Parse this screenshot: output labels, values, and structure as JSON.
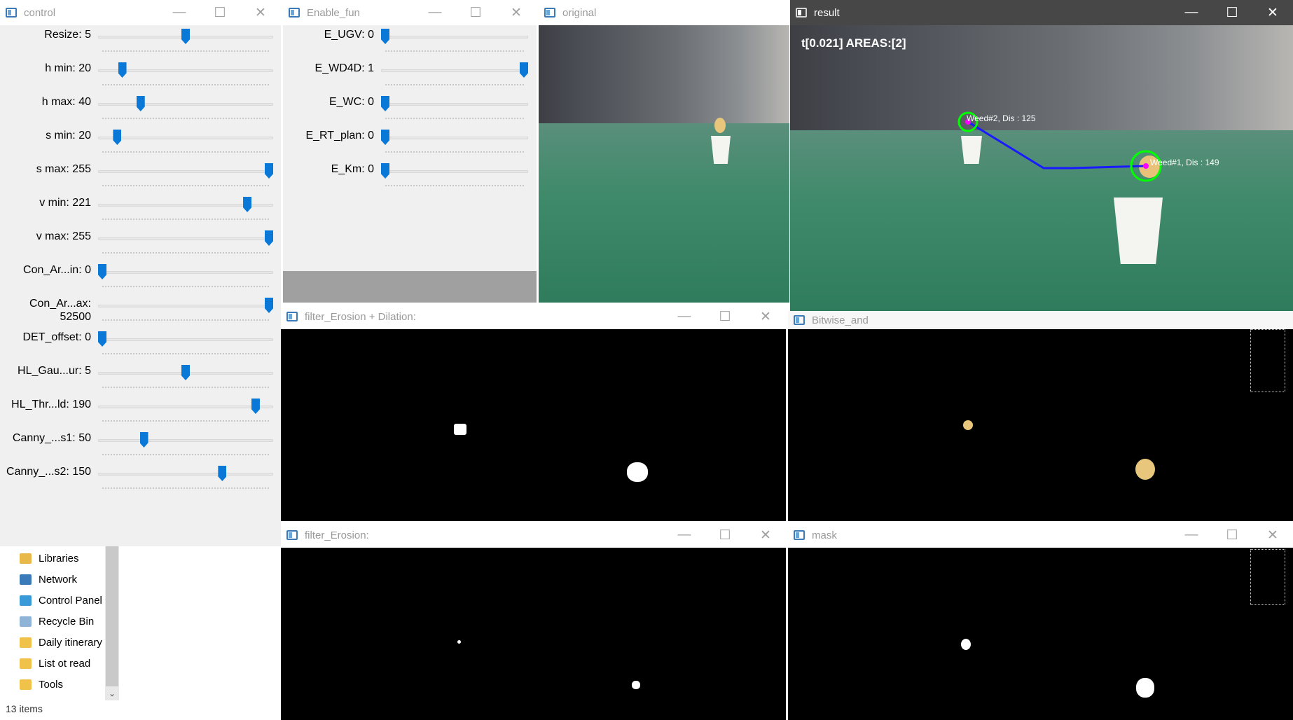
{
  "control": {
    "title": "control",
    "trackbars": [
      {
        "label": "Resize: 5",
        "pos": 0.5
      },
      {
        "label": "h min: 20",
        "pos": 0.12
      },
      {
        "label": "h max: 40",
        "pos": 0.23
      },
      {
        "label": "s min: 20",
        "pos": 0.09
      },
      {
        "label": "s max: 255",
        "pos": 1.0
      },
      {
        "label": "v min: 221",
        "pos": 0.87
      },
      {
        "label": "v max: 255",
        "pos": 1.0
      },
      {
        "label": "Con_Ar...in: 0",
        "pos": 0.0
      },
      {
        "label": "Con_Ar...ax: 52500",
        "pos": 1.0
      },
      {
        "label": "DET_offset: 0",
        "pos": 0.0
      },
      {
        "label": "HL_Gau...ur: 5",
        "pos": 0.5
      },
      {
        "label": "HL_Thr...ld: 190",
        "pos": 0.92
      },
      {
        "label": "Canny_...s1: 50",
        "pos": 0.25
      },
      {
        "label": "Canny_...s2: 150",
        "pos": 0.72
      }
    ]
  },
  "enable": {
    "title": "Enable_fun",
    "trackbars": [
      {
        "label": "E_UGV: 0",
        "pos": 0.0
      },
      {
        "label": "E_WD4D: 1",
        "pos": 1.0
      },
      {
        "label": "E_WC: 0",
        "pos": 0.0
      },
      {
        "label": "E_RT_plan: 0",
        "pos": 0.0
      },
      {
        "label": "E_Km: 0",
        "pos": 0.0
      }
    ]
  },
  "original": {
    "title": "original"
  },
  "result": {
    "title": "result",
    "overlay_text": "t[0.021] AREAS:[2]",
    "weed2_label": "Weed#2, Dis : 125",
    "weed1_label": "Weed#1, Dis : 149"
  },
  "erosion_dilation": {
    "title": "filter_Erosion + Dilation:"
  },
  "bitwise": {
    "title": "Bitwise_and"
  },
  "erosion": {
    "title": "filter_Erosion:"
  },
  "mask": {
    "title": "mask"
  },
  "explorer": {
    "items": [
      {
        "label": "Libraries",
        "icon": "libraries-icon"
      },
      {
        "label": "Network",
        "icon": "network-icon"
      },
      {
        "label": "Control Panel",
        "icon": "control-panel-icon"
      },
      {
        "label": "Recycle Bin",
        "icon": "recycle-bin-icon"
      },
      {
        "label": "Daily itinerary",
        "icon": "folder-icon"
      },
      {
        "label": "List ot read",
        "icon": "folder-icon"
      },
      {
        "label": "Tools",
        "icon": "folder-icon"
      }
    ],
    "status": "13 items"
  },
  "window_buttons": {
    "minimize": "—",
    "maximize": "☐",
    "close": "✕"
  },
  "colors": {
    "accent": "#0a78d7",
    "path_line": "#1a1aff",
    "circle": "#00ff00",
    "center_dot": "#ff00ff"
  }
}
